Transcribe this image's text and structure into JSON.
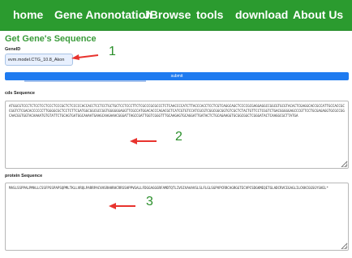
{
  "nav": {
    "items": [
      {
        "label": "home"
      },
      {
        "label": "Gene Anonotation"
      },
      {
        "label": "JBrowse"
      },
      {
        "label": "tools"
      },
      {
        "label": "download"
      },
      {
        "label": "About Us"
      }
    ]
  },
  "form": {
    "title": "Get Gene's Sequence",
    "gene_id_label": "GeneID",
    "gene_id_value": "evm.model.CTG_10.8_Akon",
    "submit_label": "submit"
  },
  "cds": {
    "label": "cds Sequence",
    "sequence": "ATGGCGTCCCTCTCCTCCTCCCTCCCGCTCTCCCCCACCACCTCCTCCTGCTGCTCCTCCCTTCTCGCCCGCGCCCTCTCAACCCCATCTTACCCACCTCCTCGTCAGGCAGCTCCCCGCGAGGAGGCCGGCGTGCGTACACTCGAGGCACCGCCATTGCCACCGCCGGTCTCGACACCCCCCTTGGGGCGCTCCTCTTCGATGGCGGCGCCGGTGGGGGGAGGTTCGCCATGGACACCCAGACGCTCATCGTGTCCATCGCGTCGGCGGCGGTGTCGCTCTACTGTTCCTCGGTCTGACGGGGGAGCCCGTTCCTGCGAGAGGTGCGCCGGCAACGGTGGTACAAAATGTGTATTCTGCAGTGATGGCAAAATGAAGCAAGAAACGGGATTAGCCGATTGGTCGGGTTTGCAAGAGTGCAGGATTGATACTCTGCAGAAGGTGCGGCGGCTCGGGATACTCAAGGCGCTTATGA"
  },
  "protein": {
    "label": "protein Sequence",
    "sequence": "MASLSSPPALPMHLLCSSFPSSPAPSQPMLTKLLVRQLPARRPACVHSRHHRHCRRSSHPPVGALLFDGGAGGGRFAMDTQTLIVSIVAAAVSLSLFLGLSGPVPCRRCAGRGGTECVPCSDGKMEQETGLADCRVCEGAGLILCKKCGGSGYSHEL*"
  },
  "annotations": [
    "1",
    "2",
    "3"
  ]
}
